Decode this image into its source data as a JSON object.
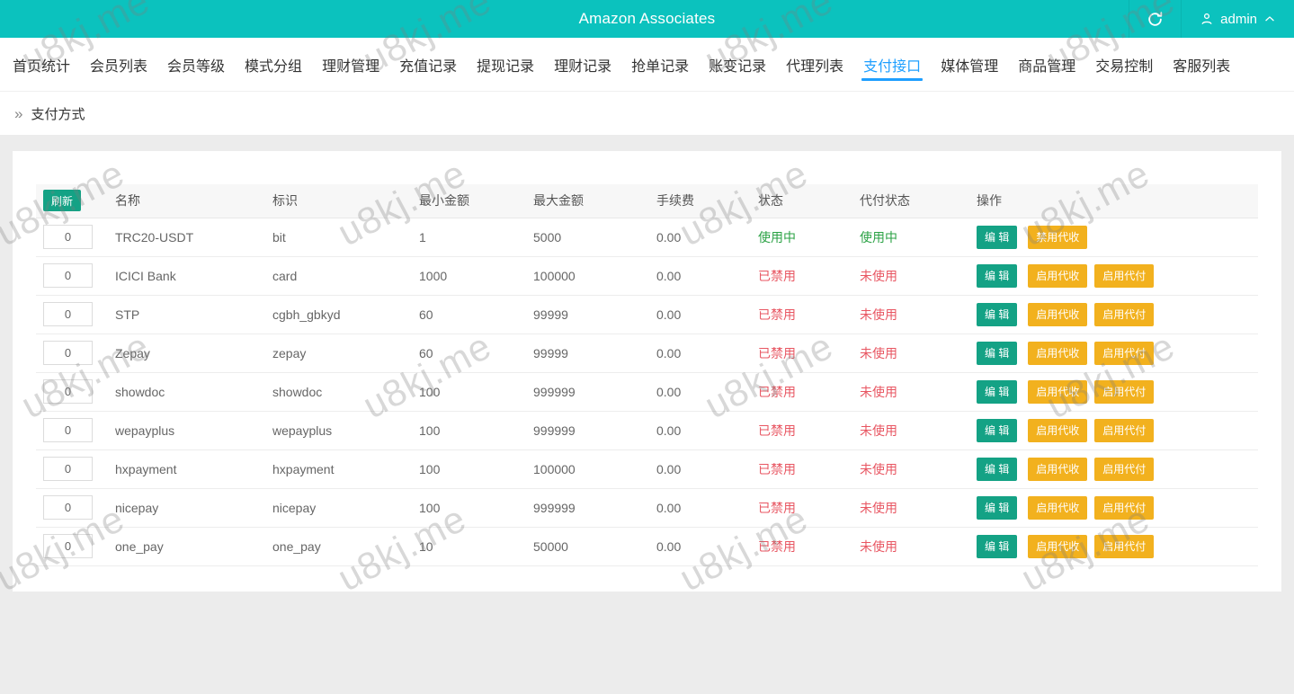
{
  "topbar": {
    "title": "Amazon Associates",
    "user": "admin"
  },
  "nav": {
    "tabs": [
      "首页统计",
      "会员列表",
      "会员等级",
      "模式分组",
      "理财管理",
      "充值记录",
      "提现记录",
      "理财记录",
      "抢单记录",
      "账变记录",
      "代理列表",
      "支付接口",
      "媒体管理",
      "商品管理",
      "交易控制",
      "客服列表"
    ],
    "active_index": 11
  },
  "breadcrumb": {
    "arrows": "»",
    "label": "支付方式"
  },
  "table": {
    "refresh_label": "刷新",
    "edit_label": "编 辑",
    "columns": [
      "名称",
      "标识",
      "最小金额",
      "最大金额",
      "手续费",
      "状态",
      "代付状态",
      "操作"
    ],
    "rows": [
      {
        "sort": "0",
        "name": "TRC20-USDT",
        "code": "bit",
        "min": "1",
        "max": "5000",
        "fee": "0.00",
        "status": "使用中",
        "status_ok": true,
        "payout": "使用中",
        "payout_ok": true,
        "actions": [
          "禁用代收"
        ]
      },
      {
        "sort": "0",
        "name": "ICICI Bank",
        "code": "card",
        "min": "1000",
        "max": "100000",
        "fee": "0.00",
        "status": "已禁用",
        "status_ok": false,
        "payout": "未使用",
        "payout_ok": false,
        "actions": [
          "启用代收",
          "启用代付"
        ]
      },
      {
        "sort": "0",
        "name": "STP",
        "code": "cgbh_gbkyd",
        "min": "60",
        "max": "99999",
        "fee": "0.00",
        "status": "已禁用",
        "status_ok": false,
        "payout": "未使用",
        "payout_ok": false,
        "actions": [
          "启用代收",
          "启用代付"
        ]
      },
      {
        "sort": "0",
        "name": "Zepay",
        "code": "zepay",
        "min": "60",
        "max": "99999",
        "fee": "0.00",
        "status": "已禁用",
        "status_ok": false,
        "payout": "未使用",
        "payout_ok": false,
        "actions": [
          "启用代收",
          "启用代付"
        ]
      },
      {
        "sort": "0",
        "name": "showdoc",
        "code": "showdoc",
        "min": "100",
        "max": "999999",
        "fee": "0.00",
        "status": "已禁用",
        "status_ok": false,
        "payout": "未使用",
        "payout_ok": false,
        "actions": [
          "启用代收",
          "启用代付"
        ]
      },
      {
        "sort": "0",
        "name": "wepayplus",
        "code": "wepayplus",
        "min": "100",
        "max": "999999",
        "fee": "0.00",
        "status": "已禁用",
        "status_ok": false,
        "payout": "未使用",
        "payout_ok": false,
        "actions": [
          "启用代收",
          "启用代付"
        ]
      },
      {
        "sort": "0",
        "name": "hxpayment",
        "code": "hxpayment",
        "min": "100",
        "max": "100000",
        "fee": "0.00",
        "status": "已禁用",
        "status_ok": false,
        "payout": "未使用",
        "payout_ok": false,
        "actions": [
          "启用代收",
          "启用代付"
        ]
      },
      {
        "sort": "0",
        "name": "nicepay",
        "code": "nicepay",
        "min": "100",
        "max": "999999",
        "fee": "0.00",
        "status": "已禁用",
        "status_ok": false,
        "payout": "未使用",
        "payout_ok": false,
        "actions": [
          "启用代收",
          "启用代付"
        ]
      },
      {
        "sort": "0",
        "name": "one_pay",
        "code": "one_pay",
        "min": "10",
        "max": "50000",
        "fee": "0.00",
        "status": "已禁用",
        "status_ok": false,
        "payout": "未使用",
        "payout_ok": false,
        "actions": [
          "启用代收",
          "启用代付"
        ]
      }
    ]
  },
  "watermark": {
    "text": "u8kj.me"
  },
  "colors": {
    "teal": "#0bc2be",
    "active-blue": "#1e9fff",
    "btn-green": "#14a285",
    "btn-amber": "#f2b11e",
    "status-green": "#2ba245",
    "status-red": "#e85662"
  }
}
